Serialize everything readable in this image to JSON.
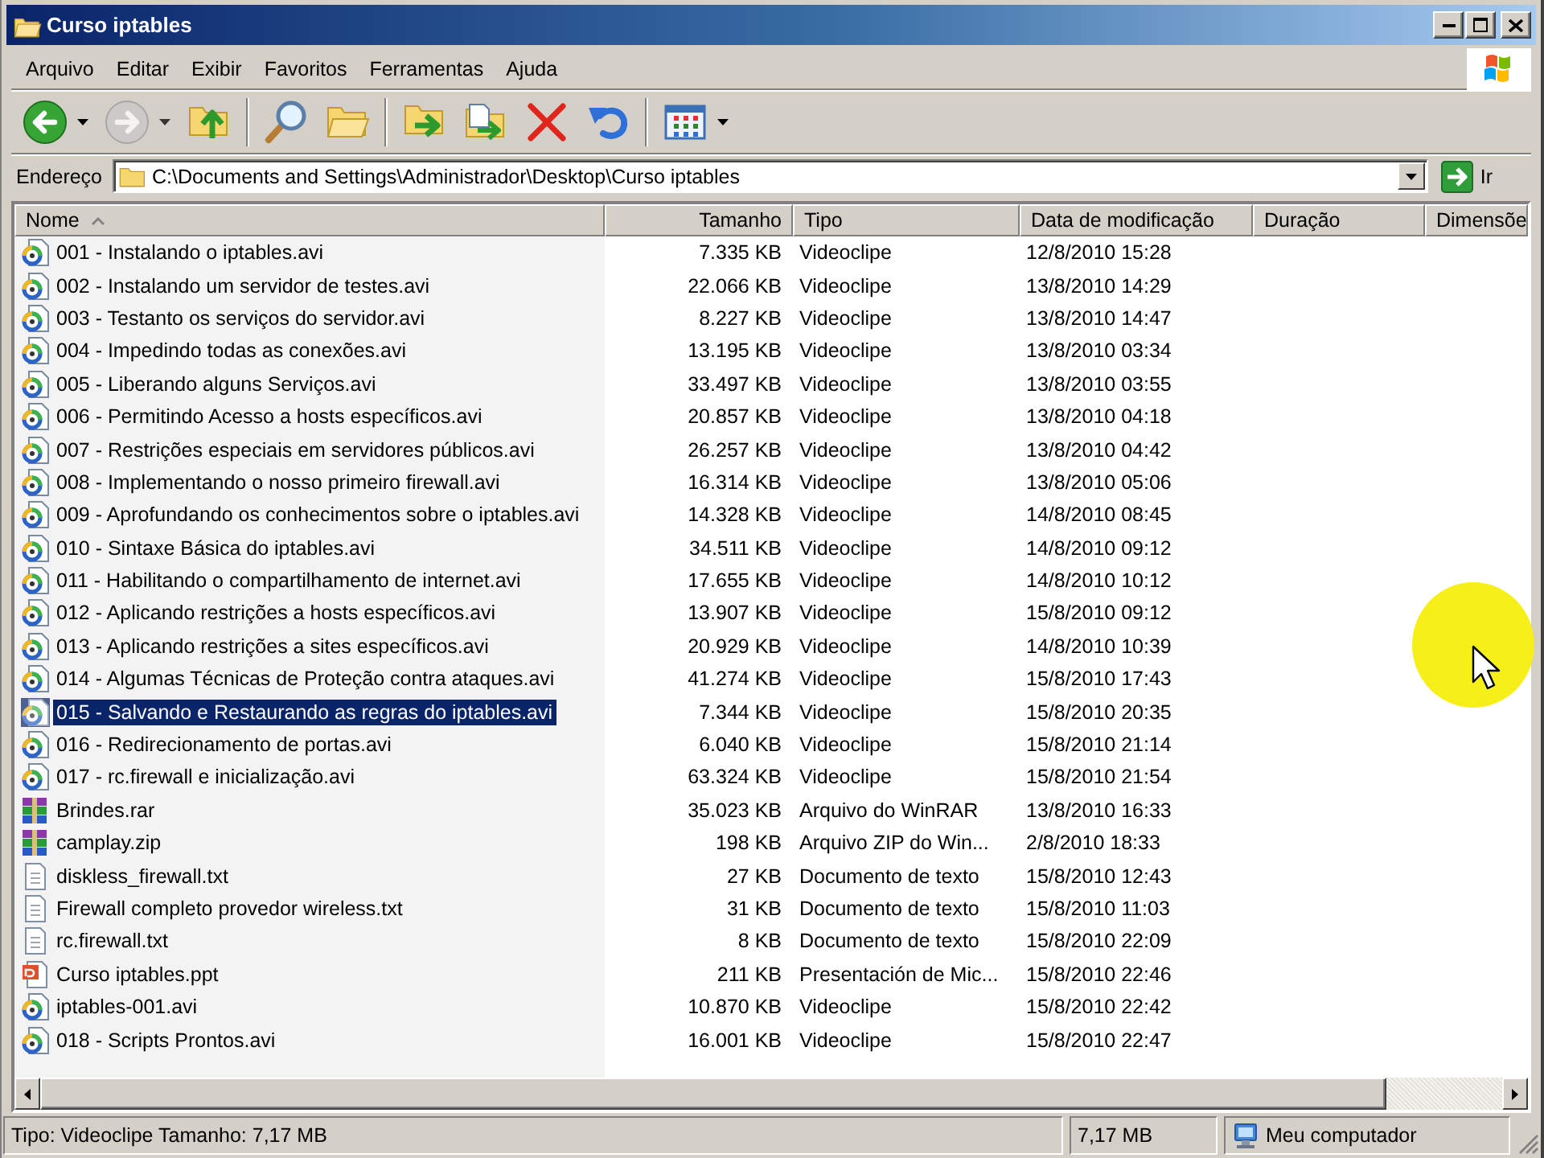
{
  "window": {
    "title": "Curso iptables"
  },
  "menu": [
    "Arquivo",
    "Editar",
    "Exibir",
    "Favoritos",
    "Ferramentas",
    "Ajuda"
  ],
  "toolbar": {
    "groups": [
      {
        "buttons": [
          {
            "kind": "back",
            "disabled": false,
            "dropdown": true
          },
          {
            "kind": "forward",
            "disabled": true,
            "dropdown": true
          },
          {
            "kind": "up",
            "disabled": false,
            "dropdown": false
          }
        ]
      },
      {
        "buttons": [
          {
            "kind": "search",
            "disabled": false,
            "dropdown": false
          },
          {
            "kind": "folders",
            "disabled": false,
            "dropdown": false
          }
        ]
      },
      {
        "buttons": [
          {
            "kind": "move",
            "disabled": false,
            "dropdown": false
          },
          {
            "kind": "copy",
            "disabled": false,
            "dropdown": false
          },
          {
            "kind": "delete",
            "disabled": false,
            "dropdown": false
          },
          {
            "kind": "undo",
            "disabled": false,
            "dropdown": false
          }
        ]
      },
      {
        "buttons": [
          {
            "kind": "views",
            "disabled": false,
            "dropdown": true
          }
        ]
      }
    ]
  },
  "address_bar": {
    "label": "Endereço",
    "value": "C:\\Documents and Settings\\Administrador\\Desktop\\Curso iptables",
    "go_label": "Ir"
  },
  "table": {
    "columns": [
      {
        "label": "Nome",
        "sorted": true
      },
      {
        "label": "Tamanho",
        "sorted": false
      },
      {
        "label": "Tipo",
        "sorted": false
      },
      {
        "label": "Data de modificação",
        "sorted": false
      },
      {
        "label": "Duração",
        "sorted": false
      },
      {
        "label": "Dimensõe",
        "sorted": false
      }
    ],
    "rows": [
      {
        "kind": "video",
        "name": "001 - Instalando o iptables.avi",
        "size": "7.335 KB",
        "type": "Videoclipe",
        "modified": "12/8/2010 15:28",
        "selected": false
      },
      {
        "kind": "video",
        "name": "002 - Instalando um servidor de testes.avi",
        "size": "22.066 KB",
        "type": "Videoclipe",
        "modified": "13/8/2010 14:29",
        "selected": false
      },
      {
        "kind": "video",
        "name": "003 - Testanto os serviços do servidor.avi",
        "size": "8.227 KB",
        "type": "Videoclipe",
        "modified": "13/8/2010 14:47",
        "selected": false
      },
      {
        "kind": "video",
        "name": "004 - Impedindo todas as conexões.avi",
        "size": "13.195 KB",
        "type": "Videoclipe",
        "modified": "13/8/2010 03:34",
        "selected": false
      },
      {
        "kind": "video",
        "name": "005 - Liberando alguns Serviços.avi",
        "size": "33.497 KB",
        "type": "Videoclipe",
        "modified": "13/8/2010 03:55",
        "selected": false
      },
      {
        "kind": "video",
        "name": "006 - Permitindo Acesso a hosts específicos.avi",
        "size": "20.857 KB",
        "type": "Videoclipe",
        "modified": "13/8/2010 04:18",
        "selected": false
      },
      {
        "kind": "video",
        "name": "007 - Restrições especiais em servidores públicos.avi",
        "size": "26.257 KB",
        "type": "Videoclipe",
        "modified": "13/8/2010 04:42",
        "selected": false
      },
      {
        "kind": "video",
        "name": "008 - Implementando o nosso primeiro firewall.avi",
        "size": "16.314 KB",
        "type": "Videoclipe",
        "modified": "13/8/2010 05:06",
        "selected": false
      },
      {
        "kind": "video",
        "name": "009 - Aprofundando os conhecimentos sobre o iptables.avi",
        "size": "14.328 KB",
        "type": "Videoclipe",
        "modified": "14/8/2010 08:45",
        "selected": false
      },
      {
        "kind": "video",
        "name": "010 - Sintaxe Básica do iptables.avi",
        "size": "34.511 KB",
        "type": "Videoclipe",
        "modified": "14/8/2010 09:12",
        "selected": false
      },
      {
        "kind": "video",
        "name": "011 - Habilitando o compartilhamento de internet.avi",
        "size": "17.655 KB",
        "type": "Videoclipe",
        "modified": "14/8/2010 10:12",
        "selected": false
      },
      {
        "kind": "video",
        "name": "012 - Aplicando restrições a hosts específicos.avi",
        "size": "13.907 KB",
        "type": "Videoclipe",
        "modified": "15/8/2010 09:12",
        "selected": false
      },
      {
        "kind": "video",
        "name": "013 - Aplicando restrições a sites específicos.avi",
        "size": "20.929 KB",
        "type": "Videoclipe",
        "modified": "14/8/2010 10:39",
        "selected": false
      },
      {
        "kind": "video",
        "name": "014 - Algumas Técnicas de Proteção contra ataques.avi",
        "size": "41.274 KB",
        "type": "Videoclipe",
        "modified": "15/8/2010 17:43",
        "selected": false
      },
      {
        "kind": "video",
        "name": "015 - Salvando e Restaurando as regras do iptables.avi",
        "size": "7.344 KB",
        "type": "Videoclipe",
        "modified": "15/8/2010 20:35",
        "selected": true
      },
      {
        "kind": "video",
        "name": "016 - Redirecionamento de portas.avi",
        "size": "6.040 KB",
        "type": "Videoclipe",
        "modified": "15/8/2010 21:14",
        "selected": false
      },
      {
        "kind": "video",
        "name": "017 - rc.firewall e inicialização.avi",
        "size": "63.324 KB",
        "type": "Videoclipe",
        "modified": "15/8/2010 21:54",
        "selected": false
      },
      {
        "kind": "archive",
        "name": "Brindes.rar",
        "size": "35.023 KB",
        "type": "Arquivo do WinRAR",
        "modified": "13/8/2010 16:33",
        "selected": false
      },
      {
        "kind": "archive",
        "name": "camplay.zip",
        "size": "198 KB",
        "type": "Arquivo ZIP do Win...",
        "modified": "2/8/2010 18:33",
        "selected": false
      },
      {
        "kind": "text",
        "name": "diskless_firewall.txt",
        "size": "27 KB",
        "type": "Documento de texto",
        "modified": "15/8/2010 12:43",
        "selected": false
      },
      {
        "kind": "text",
        "name": "Firewall completo provedor wireless.txt",
        "size": "31 KB",
        "type": "Documento de texto",
        "modified": "15/8/2010 11:03",
        "selected": false
      },
      {
        "kind": "text",
        "name": "rc.firewall.txt",
        "size": "8 KB",
        "type": "Documento de texto",
        "modified": "15/8/2010 22:09",
        "selected": false
      },
      {
        "kind": "presentation",
        "name": "Curso iptables.ppt",
        "size": "211 KB",
        "type": "Presentación de Mic...",
        "modified": "15/8/2010 22:46",
        "selected": false
      },
      {
        "kind": "video",
        "name": "iptables-001.avi",
        "size": "10.870 KB",
        "type": "Videoclipe",
        "modified": "15/8/2010 22:42",
        "selected": false
      },
      {
        "kind": "video",
        "name": "018 - Scripts Prontos.avi",
        "size": "16.001 KB",
        "type": "Videoclipe",
        "modified": "15/8/2010 22:47",
        "selected": false
      }
    ]
  },
  "status_bar": {
    "details": "Tipo: Videoclipe Tamanho: 7,17 MB",
    "size": "7,17 MB",
    "zone": "Meu computador"
  }
}
